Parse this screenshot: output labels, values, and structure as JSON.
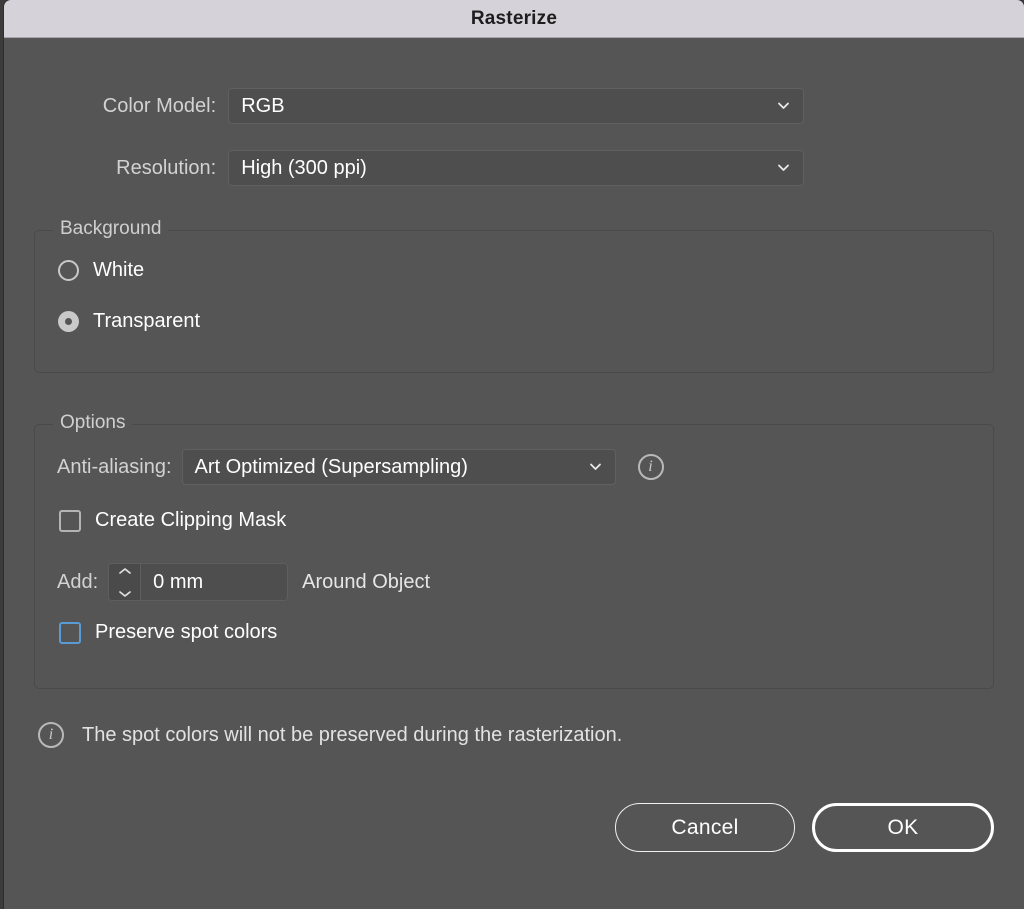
{
  "window": {
    "title": "Rasterize"
  },
  "fields": {
    "color_model": {
      "label": "Color Model:",
      "value": "RGB",
      "icon": "chevron-down-icon"
    },
    "resolution": {
      "label": "Resolution:",
      "value": "High (300 ppi)",
      "icon": "chevron-down-icon"
    }
  },
  "background_group": {
    "title": "Background",
    "options": [
      {
        "label": "White",
        "selected": false
      },
      {
        "label": "Transparent",
        "selected": true
      }
    ]
  },
  "options_group": {
    "title": "Options",
    "anti_aliasing": {
      "label": "Anti-aliasing:",
      "value": "Art Optimized (Supersampling)",
      "icon": "chevron-down-icon",
      "help_icon": "info-icon",
      "help_glyph": "i"
    },
    "create_clipping_mask": {
      "label": "Create Clipping Mask",
      "checked": false
    },
    "add": {
      "label": "Add:",
      "value": "0 mm",
      "placeholder": "0 mm",
      "suffix": "Around Object",
      "stepper_up_icon": "chevron-up-icon",
      "stepper_down_icon": "chevron-down-icon"
    },
    "preserve_spot_colors": {
      "label": "Preserve spot colors",
      "checked": false,
      "focused": true
    }
  },
  "note": {
    "icon": "info-icon",
    "icon_glyph": "i",
    "text": "The spot colors will not be preserved during the rasterization."
  },
  "buttons": {
    "cancel": "Cancel",
    "ok": "OK"
  },
  "colors": {
    "dialog_background": "#555555",
    "titlebar_background": "#d6d2d9",
    "control_background": "#4e4e4e",
    "focus_blue": "#5b9bd5",
    "text_primary": "#ffffff",
    "text_secondary": "#d2d2d2"
  }
}
